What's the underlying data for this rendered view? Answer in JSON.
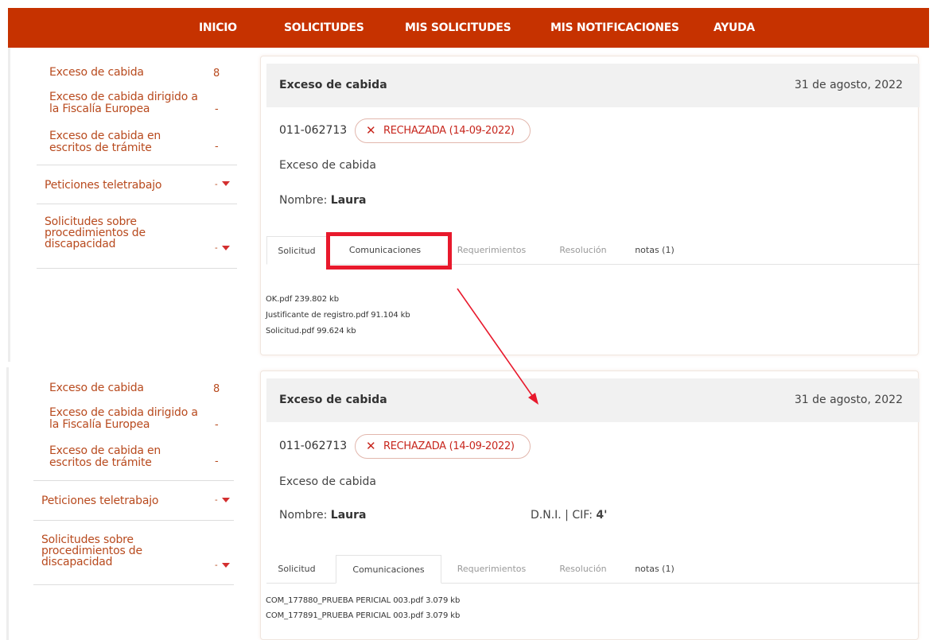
{
  "nav": {
    "items": [
      "INICIO",
      "SOLICITUDES",
      "MIS SOLICITUDES",
      "MIS NOTIFICACIONES",
      "AYUDA"
    ],
    "color": "#c63200"
  },
  "sidebar": {
    "link1": "Exceso de cabida",
    "link1_count": "8",
    "link2_line1": "Exceso de cabida dirigido a",
    "link2_line2": "la Fiscalía Europea",
    "link2_count": "-",
    "link3_line1": "Exceso de cabida en",
    "link3_line2": "escritos de trámite",
    "link3_count": "-",
    "section1": "Peticiones teletrabajo",
    "section2_line1": "Solicitudes sobre",
    "section2_line2": "procedimientos de",
    "section2_line3": "discapacidad",
    "caret_dot": "-"
  },
  "card_top": {
    "title": "Exceso de cabida",
    "date": "31 de agosto, 2022",
    "ref": "011-062713",
    "status": "RECHAZADA (14-09-2022)",
    "status_icon": "close-x-icon",
    "description": "Exceso de cabida",
    "name_label": "Nombre:",
    "name_value": "Laura",
    "tabs": [
      "Solicitud",
      "Comunicaciones",
      "Requerimientos",
      "Resolución",
      "notas (1)"
    ],
    "active_tab": "Solicitud",
    "files": [
      "OK.pdf 239.802 kb",
      "Justificante de registro.pdf 91.104 kb",
      "Solicitud.pdf 99.624 kb"
    ]
  },
  "card_bottom": {
    "title": "Exceso de cabida",
    "date": "31 de agosto, 2022",
    "ref": "011-062713",
    "status": "RECHAZADA (14-09-2022)",
    "description": "Exceso de cabida",
    "name_label": "Nombre:",
    "name_value": "Laura",
    "dni_label": "D.N.I. | CIF:",
    "dni_value": "4'",
    "tabs": [
      "Solicitud",
      "Comunicaciones",
      "Requerimientos",
      "Resolución",
      "notas (1)"
    ],
    "active_tab": "Comunicaciones",
    "files": [
      "COM_177880_PRUEBA PERICIAL 003.pdf 3.079 kb",
      "COM_177891_PRUEBA PERICIAL 003.pdf 3.079 kb"
    ]
  },
  "annotation": {
    "color": "#e8192c"
  }
}
